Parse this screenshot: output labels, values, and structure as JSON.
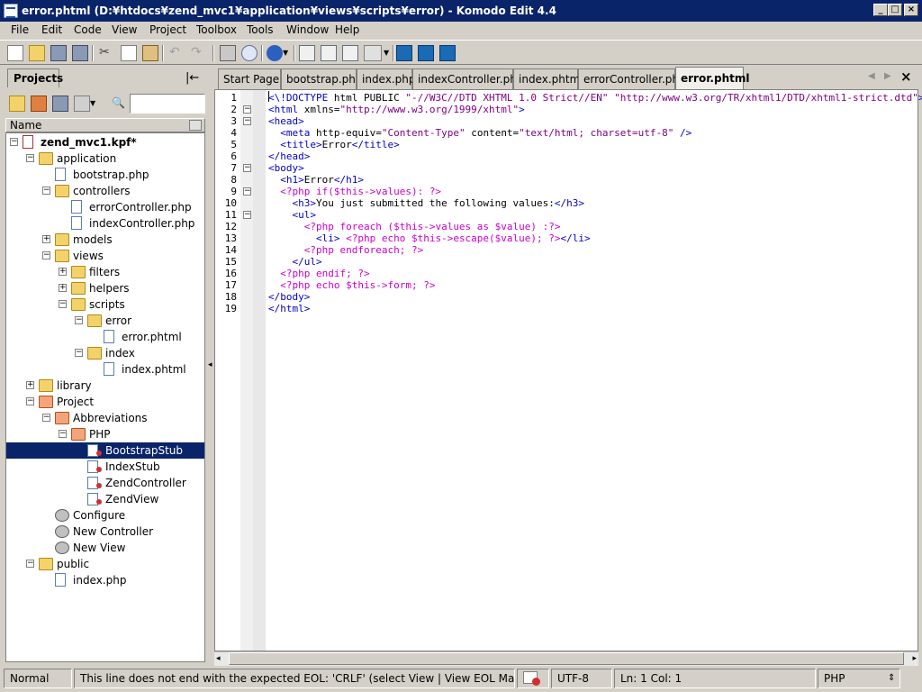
{
  "window": {
    "title": "error.phtml (D:¥htdocs¥zend_mvc1¥application¥views¥scripts¥error) - Komodo Edit 4.4",
    "minimize": "_",
    "maximize": "□",
    "close": "×"
  },
  "menu": [
    "File",
    "Edit",
    "Code",
    "View",
    "Project",
    "Toolbox",
    "Tools",
    "Window",
    "Help"
  ],
  "projects_panel": {
    "tab_label": "Projects",
    "collapse_glyph": "|←",
    "search_glyph": "🔍",
    "column_header": "Name"
  },
  "tree": [
    {
      "label": "zend_mvc1.kpf*",
      "depth": 0,
      "type": "kpf",
      "expanded": true,
      "bold": true
    },
    {
      "label": "application",
      "depth": 1,
      "type": "folder",
      "expanded": true
    },
    {
      "label": "bootstrap.php",
      "depth": 2,
      "type": "file"
    },
    {
      "label": "controllers",
      "depth": 2,
      "type": "folder",
      "expanded": true
    },
    {
      "label": "errorController.php",
      "depth": 3,
      "type": "file"
    },
    {
      "label": "indexController.php",
      "depth": 3,
      "type": "file"
    },
    {
      "label": "models",
      "depth": 2,
      "type": "folder",
      "expanded": false
    },
    {
      "label": "views",
      "depth": 2,
      "type": "folder",
      "expanded": true
    },
    {
      "label": "filters",
      "depth": 3,
      "type": "folder",
      "expanded": false
    },
    {
      "label": "helpers",
      "depth": 3,
      "type": "folder",
      "expanded": false
    },
    {
      "label": "scripts",
      "depth": 3,
      "type": "folder",
      "expanded": true
    },
    {
      "label": "error",
      "depth": 4,
      "type": "folder",
      "expanded": true
    },
    {
      "label": "error.phtml",
      "depth": 5,
      "type": "file"
    },
    {
      "label": "index",
      "depth": 4,
      "type": "folder",
      "expanded": true
    },
    {
      "label": "index.phtml",
      "depth": 5,
      "type": "file"
    },
    {
      "label": "library",
      "depth": 1,
      "type": "folder",
      "expanded": false
    },
    {
      "label": "Project",
      "depth": 1,
      "type": "folder-red",
      "expanded": true
    },
    {
      "label": "Abbreviations",
      "depth": 2,
      "type": "folder-red",
      "expanded": true
    },
    {
      "label": "PHP",
      "depth": 3,
      "type": "folder-red",
      "expanded": true
    },
    {
      "label": "BootstrapStub",
      "depth": 4,
      "type": "snippet",
      "selected": true
    },
    {
      "label": "IndexStub",
      "depth": 4,
      "type": "snippet"
    },
    {
      "label": "ZendController",
      "depth": 4,
      "type": "snippet"
    },
    {
      "label": "ZendView",
      "depth": 4,
      "type": "snippet"
    },
    {
      "label": "Configure",
      "depth": 2,
      "type": "gear"
    },
    {
      "label": "New Controller",
      "depth": 2,
      "type": "gear"
    },
    {
      "label": "New View",
      "depth": 2,
      "type": "gear"
    },
    {
      "label": "public",
      "depth": 1,
      "type": "folder",
      "expanded": true
    },
    {
      "label": "index.php",
      "depth": 2,
      "type": "file"
    }
  ],
  "editor_tabs": [
    {
      "label": "Start Page"
    },
    {
      "label": "bootstrap.php"
    },
    {
      "label": "index.php"
    },
    {
      "label": "indexController.php"
    },
    {
      "label": "index.phtml"
    },
    {
      "label": "errorController.php"
    },
    {
      "label": "error.phtml",
      "active": true
    }
  ],
  "tab_nav": {
    "prev": "◀",
    "next": "▶",
    "close": "×"
  },
  "code_lines": [
    "<\\!DOCTYPE html PUBLIC \"-//W3C//DTD XHTML 1.0 Strict//EN\" \"http://www.w3.org/TR/xhtml1/DTD/xhtml1-strict.dtd\">",
    "<html xmlns=\"http://www.w3.org/1999/xhtml\">",
    "<head>",
    "  <meta http-equiv=\"Content-Type\" content=\"text/html; charset=utf-8\" />",
    "  <title>Error</title>",
    "</head>",
    "<body>",
    "  <h1>Error</h1>",
    "  <?php if($this->values): ?>",
    "    <h3>You just submitted the following values:</h3>",
    "    <ul>",
    "      <?php foreach ($this->values as $value) :?>",
    "        <li> <?php echo $this->escape($value); ?></li>",
    "      <?php endforeach; ?>",
    "    </ul>",
    "  <?php endif; ?>",
    "  <?php echo $this->form; ?>",
    "</body>",
    "</html>"
  ],
  "fold_lines": [
    2,
    3,
    7,
    9,
    11
  ],
  "status": {
    "mode": "Normal",
    "message": "This line does not end with the expected EOL: 'CRLF' (select View | View EOL Markers)",
    "encoding": "UTF-8",
    "position": "Ln: 1 Col: 1",
    "language": "PHP",
    "language_arrow": "⇕"
  }
}
